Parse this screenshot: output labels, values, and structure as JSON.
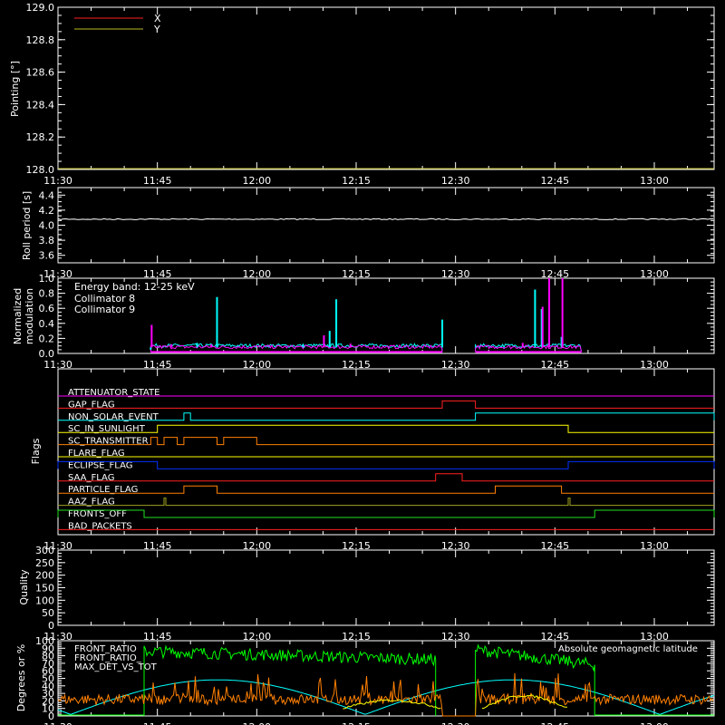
{
  "time_ticks": [
    "11:30",
    "11:45",
    "12:00",
    "12:15",
    "12:30",
    "12:45",
    "13:00"
  ],
  "chart_data": [
    {
      "type": "line",
      "ylabel": "Pointing [°]",
      "ylim": [
        128.0,
        129.0
      ],
      "yticks": [
        "128.0",
        "128.2",
        "128.4",
        "128.6",
        "128.8",
        "129.0"
      ],
      "legend": "top-left",
      "series": [
        {
          "name": "X",
          "color": "#ff2020",
          "values": []
        },
        {
          "name": "Y",
          "color": "#b8b820",
          "values": []
        }
      ]
    },
    {
      "type": "line",
      "ylabel": "Roll period [s]",
      "ylim": [
        3.5,
        4.5
      ],
      "yticks": [
        "3.6",
        "3.8",
        "4.0",
        "4.2",
        "4.4"
      ],
      "series": [
        {
          "color": "#ffffff",
          "x": [
            "11:30",
            "13:10"
          ],
          "values": [
            4.08,
            4.08
          ]
        }
      ]
    },
    {
      "type": "line",
      "ylabel": "Normalized modulation",
      "ylim": [
        0.0,
        1.0
      ],
      "yticks": [
        "0.0",
        "0.2",
        "0.4",
        "0.6",
        "0.8",
        "1.0"
      ],
      "annotation": "Energy band: 12-25 keV",
      "series": [
        {
          "name": "Collimator 8",
          "color": "#00ffff",
          "spikes": [
            [
              "11:44",
              0.05
            ],
            [
              "11:51",
              0.14
            ],
            [
              "11:54",
              0.75
            ],
            [
              "11:57",
              0.08
            ],
            [
              "12:07",
              0.12
            ],
            [
              "12:11",
              0.3
            ],
            [
              "12:12",
              0.72
            ],
            [
              "12:28",
              0.45
            ],
            [
              "12:42",
              0.85
            ],
            [
              "12:43",
              0.59
            ],
            [
              "12:46",
              0.22
            ]
          ]
        },
        {
          "name": "Collimator 9",
          "color": "#ff00ff",
          "spikes": [
            [
              "11:44",
              0.38
            ],
            [
              "11:47",
              0.12
            ],
            [
              "11:53",
              0.12
            ],
            [
              "12:10",
              0.24
            ],
            [
              "12:14",
              0.13
            ],
            [
              "12:40",
              0.14
            ],
            [
              "12:43",
              0.62
            ],
            [
              "12:44",
              1.0
            ],
            [
              "12:46",
              1.0
            ]
          ]
        }
      ],
      "baseline": 0.08,
      "active_intervals": [
        [
          "11:44",
          "12:28"
        ],
        [
          "12:33",
          "12:49"
        ]
      ]
    },
    {
      "type": "line",
      "ylabel": "Flags",
      "flags": [
        {
          "name": "ATTENUATOR_STATE",
          "color": "#ff00ff",
          "segments": []
        },
        {
          "name": "GAP_FLAG",
          "color": "#ff2020",
          "segments": [
            [
              "12:28",
              "12:33"
            ]
          ]
        },
        {
          "name": "NON_SOLAR_EVENT",
          "color": "#00ffff",
          "segments": [
            [
              "11:49",
              "11:50"
            ],
            [
              "12:33",
              "13:10"
            ]
          ]
        },
        {
          "name": "SC_IN_SUNLIGHT",
          "color": "#ffff00",
          "segments": [
            [
              "11:45",
              "12:47"
            ]
          ]
        },
        {
          "name": "SC_TRANSMITTER",
          "color": "#ff8000",
          "segments": [
            [
              "11:44",
              "11:45"
            ],
            [
              "11:46",
              "11:48"
            ],
            [
              "11:49",
              "11:54"
            ],
            [
              "11:55",
              "12:00"
            ]
          ]
        },
        {
          "name": "FLARE_FLAG",
          "color": "#ffff00",
          "segments": []
        },
        {
          "name": "ECLIPSE_FLAG",
          "color": "#0030ff",
          "segments": [
            [
              "11:30",
              "11:45"
            ],
            [
              "12:47",
              "13:10"
            ]
          ]
        },
        {
          "name": "SAA_FLAG",
          "color": "#ff2020",
          "segments": [
            [
              "12:27",
              "12:31"
            ]
          ]
        },
        {
          "name": "PARTICLE_FLAG",
          "color": "#ff8000",
          "segments": [
            [
              "11:49",
              "11:54"
            ],
            [
              "12:36",
              "12:46"
            ]
          ]
        },
        {
          "name": "AAZ_FLAG",
          "color": "#a0a020",
          "segments": [
            [
              "11:46",
              "11:46"
            ],
            [
              "12:47",
              "12:47"
            ]
          ]
        },
        {
          "name": "FRONTS_OFF",
          "color": "#20e020",
          "segments": [
            [
              "11:30",
              "11:43"
            ],
            [
              "12:51",
              "13:10"
            ]
          ]
        },
        {
          "name": "BAD_PACKETS",
          "color": "#ff2020",
          "segments": []
        }
      ]
    },
    {
      "type": "line",
      "ylabel": "Quality",
      "ylim": [
        0,
        300
      ],
      "yticks": [
        "0",
        "50",
        "100",
        "150",
        "200",
        "250",
        "300"
      ],
      "series": []
    },
    {
      "type": "line",
      "ylabel": "Degrees or %",
      "ylim": [
        0,
        100
      ],
      "yticks": [
        "0",
        "10",
        "20",
        "30",
        "40",
        "50",
        "60",
        "70",
        "80",
        "90",
        "100"
      ],
      "series": [
        {
          "name": "FRONT_RATIO",
          "color": "#ffff00"
        },
        {
          "name": "FRONT_RATIO_",
          "color": "#00ff00"
        },
        {
          "name": "MAX_DET_VS_TOT",
          "color": "#ff8000"
        },
        {
          "name": "Absolute geomagnetic latitude",
          "color": "#00ffff"
        }
      ]
    }
  ]
}
